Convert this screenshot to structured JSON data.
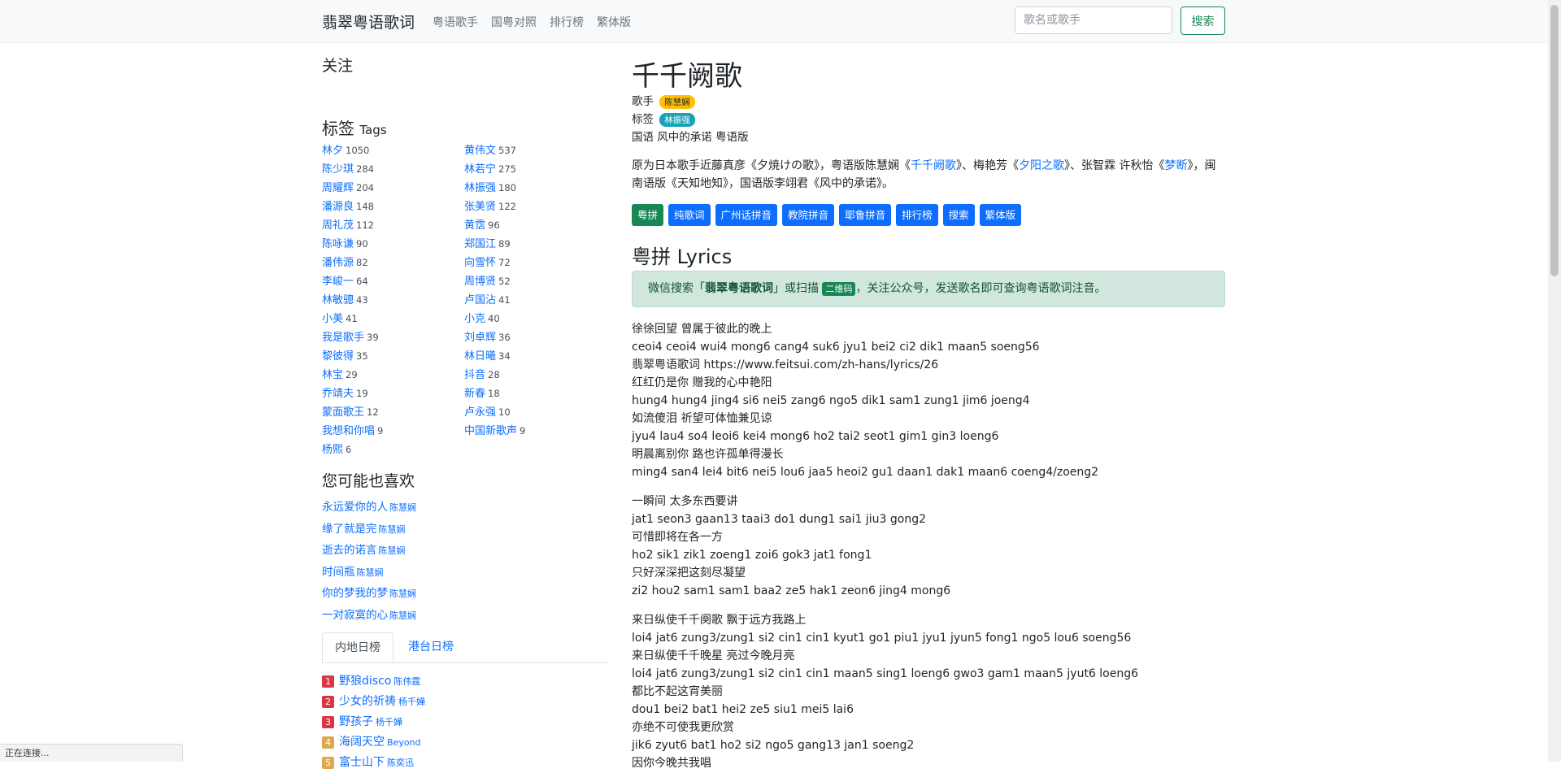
{
  "navbar": {
    "brand": "翡翠粤语歌词",
    "links": [
      "粤语歌手",
      "国粤对照",
      "排行榜",
      "繁体版"
    ],
    "search_placeholder": "歌名或歌手",
    "search_button": "搜索"
  },
  "sidebar": {
    "follow_title": "关注",
    "tags_title": "标签",
    "tags_subtitle": "Tags",
    "tags": [
      {
        "name": "林夕",
        "count": "1050"
      },
      {
        "name": "黄伟文",
        "count": "537"
      },
      {
        "name": "陈少琪",
        "count": "284"
      },
      {
        "name": "林若宁",
        "count": "275"
      },
      {
        "name": "周耀辉",
        "count": "204"
      },
      {
        "name": "林振强",
        "count": "180"
      },
      {
        "name": "潘源良",
        "count": "148"
      },
      {
        "name": "张美贤",
        "count": "122"
      },
      {
        "name": "周礼茂",
        "count": "112"
      },
      {
        "name": "黄霑",
        "count": "96"
      },
      {
        "name": "陈咏谦",
        "count": "90"
      },
      {
        "name": "郑国江",
        "count": "89"
      },
      {
        "name": "潘伟源",
        "count": "82"
      },
      {
        "name": "向雪怀",
        "count": "72"
      },
      {
        "name": "李峻一",
        "count": "64"
      },
      {
        "name": "周博贤",
        "count": "52"
      },
      {
        "name": "林敏骢",
        "count": "43"
      },
      {
        "name": "卢国沾",
        "count": "41"
      },
      {
        "name": "小美",
        "count": "41"
      },
      {
        "name": "小克",
        "count": "40"
      },
      {
        "name": "我是歌手",
        "count": "39"
      },
      {
        "name": "刘卓辉",
        "count": "36"
      },
      {
        "name": "黎彼得",
        "count": "35"
      },
      {
        "name": "林日曦",
        "count": "34"
      },
      {
        "name": "林宝",
        "count": "29"
      },
      {
        "name": "抖音",
        "count": "28"
      },
      {
        "name": "乔靖夫",
        "count": "19"
      },
      {
        "name": "新春",
        "count": "18"
      },
      {
        "name": "蒙面歌王",
        "count": "12"
      },
      {
        "name": "卢永强",
        "count": "10"
      },
      {
        "name": "我想和你唱",
        "count": "9"
      },
      {
        "name": "中国新歌声",
        "count": "9"
      },
      {
        "name": "杨熙",
        "count": "6"
      }
    ],
    "like_title": "您可能也喜欢",
    "likes": [
      {
        "song": "永远爱你的人",
        "artist": "陈慧娴"
      },
      {
        "song": "缘了就是完",
        "artist": "陈慧娴"
      },
      {
        "song": "逝去的诺言",
        "artist": "陈慧娴"
      },
      {
        "song": "时间瓶",
        "artist": "陈慧娴"
      },
      {
        "song": "你的梦我的梦",
        "artist": "陈慧娴"
      },
      {
        "song": "一对寂寞的心",
        "artist": "陈慧娴"
      }
    ],
    "tabs": [
      "内地日榜",
      "港台日榜"
    ],
    "rankings": [
      {
        "rank": "1",
        "song": "野狼disco",
        "artist": "陈伟霆",
        "color": "#dc3545"
      },
      {
        "rank": "2",
        "song": "少女的祈祷",
        "artist": "杨千嬅",
        "color": "#dc3545"
      },
      {
        "rank": "3",
        "song": "野孩子",
        "artist": "杨千嬅",
        "color": "#dc3545"
      },
      {
        "rank": "4",
        "song": "海阔天空",
        "artist": "Beyond",
        "color": "#e0a84e"
      },
      {
        "rank": "5",
        "song": "富士山下",
        "artist": "陈奕迅",
        "color": "#e0a84e"
      }
    ]
  },
  "song": {
    "title": "千千阙歌",
    "singer_label": "歌手",
    "singer": "陈慧娴",
    "tag_label": "标签",
    "tag": "林振强",
    "related": "国语 风中的承诺 粤语版",
    "desc_parts": [
      {
        "text": "原为日本歌手近藤真彦《夕焼けの歌》，粤语版陈慧娴《",
        "link": false
      },
      {
        "text": "千千阙歌",
        "link": true
      },
      {
        "text": "》、梅艳芳《",
        "link": false
      },
      {
        "text": "夕阳之歌",
        "link": true
      },
      {
        "text": "》、张智霖 许秋怡《",
        "link": false
      },
      {
        "text": "梦断",
        "link": true
      },
      {
        "text": "》，闽南语版《天知地知》，国语版李翊君《风中的承诺》。",
        "link": false
      }
    ],
    "buttons": [
      "粤拼",
      "纯歌词",
      "广州话拼音",
      "教院拼音",
      "耶鲁拼音",
      "排行榜",
      "搜索",
      "繁体版"
    ],
    "lyrics_title": "粤拼 Lyrics",
    "alert": {
      "pre": "微信搜索「",
      "bold": "翡翠粤语歌词",
      "mid": "」或扫描",
      "qr": "二维码",
      "post": "，关注公众号，发送歌名即可查询粤语歌词注音。"
    },
    "stanzas": [
      [
        "徐徐回望 曾属于彼此的晚上",
        "ceoi4 ceoi4 wui4 mong6 cang4 suk6 jyu1 bei2 ci2 dik1 maan5 soeng56",
        "翡翠粤语歌词 https://www.feitsui.com/zh-hans/lyrics/26",
        "红红仍是你 赠我的心中艳阳",
        "hung4 hung4 jing4 si6 nei5 zang6 ngo5 dik1 sam1 zung1 jim6 joeng4",
        "如流傻泪 祈望可体恤兼见谅",
        "jyu4 lau4 so4 leoi6 kei4 mong6 ho2 tai2 seot1 gim1 gin3 loeng6",
        "明晨离别你 路也许孤单得漫长",
        "ming4 san4 lei4 bit6 nei5 lou6 jaa5 heoi2 gu1 daan1 dak1 maan6 coeng4/zoeng2"
      ],
      [
        "一瞬间 太多东西要讲",
        "jat1 seon3 gaan13 taai3 do1 dung1 sai1 jiu3 gong2",
        "可惜即将在各一方",
        "ho2 sik1 zik1 zoeng1 zoi6 gok3 jat1 fong1",
        "只好深深把这刻尽凝望",
        "zi2 hou2 sam1 sam1 baa2 ze5 hak1 zeon6 jing4 mong6"
      ],
      [
        "来日纵使千千阕歌 飘于远方我路上",
        "loi4 jat6 zung3/zung1 si2 cin1 cin1 kyut1 go1 piu1 jyu1 jyun5 fong1 ngo5 lou6 soeng56",
        "来日纵使千千晚星 亮过今晚月亮",
        "loi4 jat6 zung3/zung1 si2 cin1 cin1 maan5 sing1 loeng6 gwo3 gam1 maan5 jyut6 loeng6",
        "都比不起这宵美丽",
        "dou1 bei2 bat1 hei2 ze5 siu1 mei5 lai6",
        "亦绝不可使我更欣赏",
        "jik6 zyut6 bat1 ho2 si2 ngo5 gang13 jan1 soeng2",
        "因你今晚共我唱"
      ]
    ]
  },
  "status_text": "正在连接..."
}
